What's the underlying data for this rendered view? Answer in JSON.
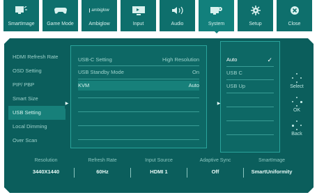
{
  "tabs": [
    {
      "label": "SmartImage",
      "icon": "smartimage-icon"
    },
    {
      "label": "Game Mode",
      "icon": "gamepad-icon"
    },
    {
      "label": "Ambiglow",
      "icon": "ambiglow-logo",
      "logo_text": "ambiglow"
    },
    {
      "label": "Input",
      "icon": "input-icon"
    },
    {
      "label": "Audio",
      "icon": "speaker-icon"
    },
    {
      "label": "System",
      "icon": "system-icon",
      "active": true
    },
    {
      "label": "Setup",
      "icon": "gear-icon"
    },
    {
      "label": "Close",
      "icon": "close-icon"
    }
  ],
  "menu": {
    "items": [
      "HDMI Refresh Rate",
      "OSD Setting",
      "PIP/ PBP",
      "Smart Size",
      "USB Setting",
      "Local Dimming",
      "Over Scan"
    ],
    "selected": "USB Setting"
  },
  "settings": [
    {
      "label": "USB-C Setting",
      "value": "High Resolution"
    },
    {
      "label": "USB Standby Mode",
      "value": "On"
    },
    {
      "label": "KVM",
      "value": "Auto",
      "selected": true
    }
  ],
  "options": {
    "items": [
      "Auto",
      "USB C",
      "USB Up"
    ],
    "selected": "Auto",
    "check_glyph": "✓"
  },
  "nav": [
    {
      "label": "Select",
      "icon": "select-dpad-icon"
    },
    {
      "label": "OK",
      "icon": "ok-dpad-icon"
    },
    {
      "label": "Back",
      "icon": "back-dpad-icon"
    }
  ],
  "status": [
    {
      "label": "Resolution",
      "value": "3440X1440"
    },
    {
      "label": "Refresh Rate",
      "value": "60Hz"
    },
    {
      "label": "Input Source",
      "value": "HDMI 1"
    },
    {
      "label": "Adaptive Sync",
      "value": "Off"
    },
    {
      "label": "SmartImage",
      "value": "SmartUniformity"
    }
  ],
  "colors": {
    "tab_bg": "#0e6f6c",
    "osd_bg": "#0b5e5c",
    "highlight": "#17807a",
    "text": "#9fd3cd"
  }
}
